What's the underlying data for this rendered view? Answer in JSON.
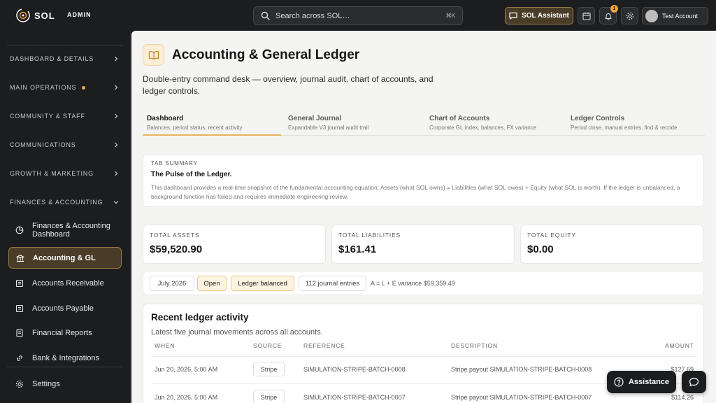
{
  "header": {
    "logo_text": "SOL",
    "admin_label": "ADMIN",
    "search_placeholder": "Search across SOL…",
    "search_shortcut": "⌘K",
    "assistant_label": "SOL Assistant",
    "notification_count": "1",
    "account_name": "Test Account",
    "accent_color": "#f0a43a"
  },
  "sidebar": {
    "sections": [
      {
        "label": "DASHBOARD & DETAILS"
      },
      {
        "label": "MAIN OPERATIONS"
      },
      {
        "label": "COMMUNITY & STAFF"
      },
      {
        "label": "COMMUNICATIONS"
      },
      {
        "label": "GROWTH & MARKETING"
      },
      {
        "label": "FINANCES & ACCOUNTING"
      }
    ],
    "items": [
      {
        "label": "Finances & Accounting Dashboard",
        "icon": "pie-chart-icon"
      },
      {
        "label": "Accounting & GL",
        "icon": "bank-icon"
      },
      {
        "label": "Accounts Receivable",
        "icon": "receivable-icon"
      },
      {
        "label": "Accounts Payable",
        "icon": "payable-icon"
      },
      {
        "label": "Financial Reports",
        "icon": "report-icon"
      },
      {
        "label": "Bank & Integrations",
        "icon": "link-icon"
      }
    ],
    "settings_label": "Settings"
  },
  "page": {
    "title": "Accounting & General Ledger",
    "description": "Double-entry command desk — overview, journal audit, chart of accounts, and ledger controls.",
    "tabs": [
      {
        "label": "Dashboard",
        "sub": "Balances, period status, recent activity"
      },
      {
        "label": "General Journal",
        "sub": "Expandable V3 journal audit trail"
      },
      {
        "label": "Chart of Accounts",
        "sub": "Corporate GL index, balances, FX variance"
      },
      {
        "label": "Ledger Controls",
        "sub": "Period close, manual entries, find & recode"
      }
    ],
    "summary": {
      "eyebrow": "TAB SUMMARY",
      "title": "The Pulse of the Ledger.",
      "body": "This dashboard provides a real-time snapshot of the fundamental accounting equation: Assets (what SOL owns) = Liabilities (what SOL owes) + Equity (what SOL is worth). If the ledger is unbalanced, a background function has failed and requires immediate engineering review."
    },
    "metrics": [
      {
        "label": "TOTAL ASSETS",
        "value": "$59,520.90"
      },
      {
        "label": "TOTAL LIABILITIES",
        "value": "$161.41"
      },
      {
        "label": "TOTAL EQUITY",
        "value": "$0.00"
      }
    ],
    "status": {
      "period": "July 2026",
      "state": "Open",
      "balance": "Ledger balanced",
      "entries": "112 journal entries",
      "variance": "A = L + E variance $59,359.49"
    },
    "activity": {
      "title": "Recent ledger activity",
      "subtitle": "Latest five journal movements across all accounts.",
      "columns": [
        "WHEN",
        "SOURCE",
        "REFERENCE",
        "DESCRIPTION",
        "AMOUNT"
      ],
      "rows": [
        {
          "when": "Jun 20, 2026, 5:00 AM",
          "source": "Stripe",
          "reference": "SIMULATION-STRIPE-BATCH-0008",
          "description": "Stripe payout SIMULATION-STRIPE-BATCH-0008",
          "amount": "$127.69"
        },
        {
          "when": "Jun 20, 2026, 5:00 AM",
          "source": "Stripe",
          "reference": "SIMULATION-STRIPE-BATCH-0007",
          "description": "Stripe payout SIMULATION-STRIPE-BATCH-0007",
          "amount": "$114.26"
        }
      ]
    }
  },
  "floating": {
    "assistance_label": "Assistance"
  }
}
